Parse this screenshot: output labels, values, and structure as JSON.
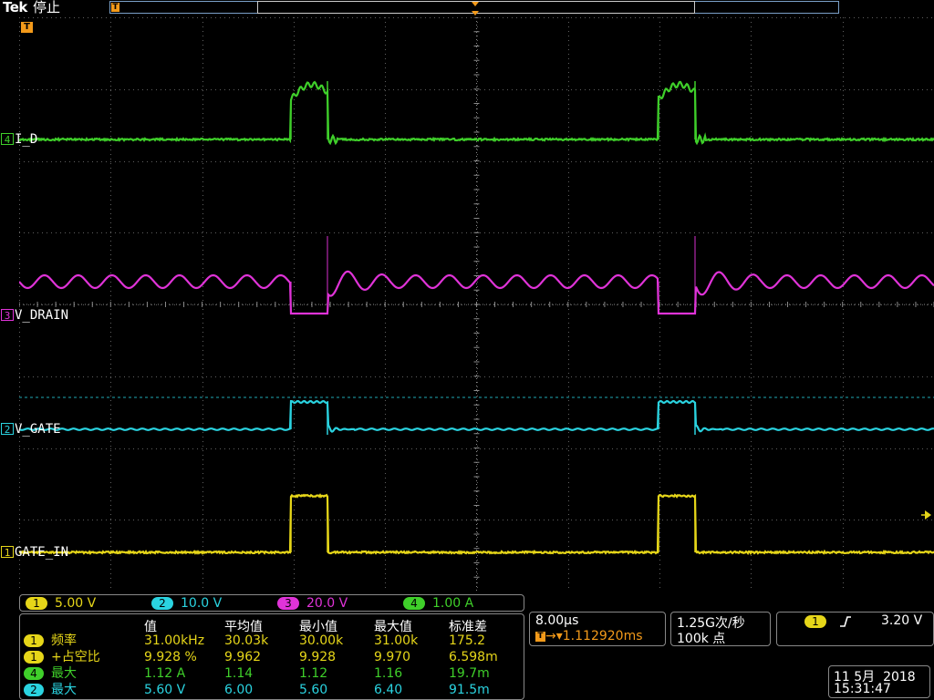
{
  "header": {
    "brand": "Tek",
    "state": "停止",
    "trigger_marker": "T"
  },
  "colors": {
    "ch1": "#e6d619",
    "ch2": "#2ad3e0",
    "ch3": "#e033d8",
    "ch4": "#3fcf2a",
    "grid": "#606060",
    "trigger": "#f39a1a"
  },
  "channels": [
    {
      "num": "4",
      "label": "I_D",
      "color": "#3fcf2a"
    },
    {
      "num": "3",
      "label": "V_DRAIN",
      "color": "#e033d8"
    },
    {
      "num": "2",
      "label": "V_GATE",
      "color": "#2ad3e0"
    },
    {
      "num": "1",
      "label": "GATE_IN",
      "color": "#e6d619"
    }
  ],
  "scales": [
    {
      "num": "1",
      "value": "5.00 V",
      "color": "#e6d619"
    },
    {
      "num": "2",
      "value": "10.0 V",
      "color": "#2ad3e0"
    },
    {
      "num": "3",
      "value": "20.0 V",
      "color": "#e033d8"
    },
    {
      "num": "4",
      "value": "1.00 A",
      "color": "#3fcf2a"
    }
  ],
  "measurements": {
    "headers": [
      "值",
      "平均值",
      "最小值",
      "最大值",
      "标准差"
    ],
    "rows": [
      {
        "num": "1",
        "color": "#e6d619",
        "name": "频率",
        "value": "31.00kHz",
        "mean": "30.03k",
        "min": "30.00k",
        "max": "31.00k",
        "std": "175.2"
      },
      {
        "num": "1",
        "color": "#e6d619",
        "name": "+占空比",
        "value": "9.928 %",
        "mean": "9.962",
        "min": "9.928",
        "max": "9.970",
        "std": "6.598m"
      },
      {
        "num": "4",
        "color": "#3fcf2a",
        "name": "最大",
        "value": "1.12 A",
        "mean": "1.14",
        "min": "1.12",
        "max": "1.16",
        "std": "19.7m"
      },
      {
        "num": "2",
        "color": "#2ad3e0",
        "name": "最大",
        "value": "5.60 V",
        "mean": "6.00",
        "min": "5.60",
        "max": "6.40",
        "std": "91.5m"
      }
    ]
  },
  "horizontal": {
    "scale": "8.00µs",
    "position": "1.112920ms"
  },
  "acquisition": {
    "rate": "1.25G次/秒",
    "points": "100k 点"
  },
  "trigger": {
    "channel": "1",
    "slope_icon": "rising-edge",
    "level": "3.20 V"
  },
  "datetime": {
    "date": "11 5月  2018",
    "time": "15:31:47"
  }
}
